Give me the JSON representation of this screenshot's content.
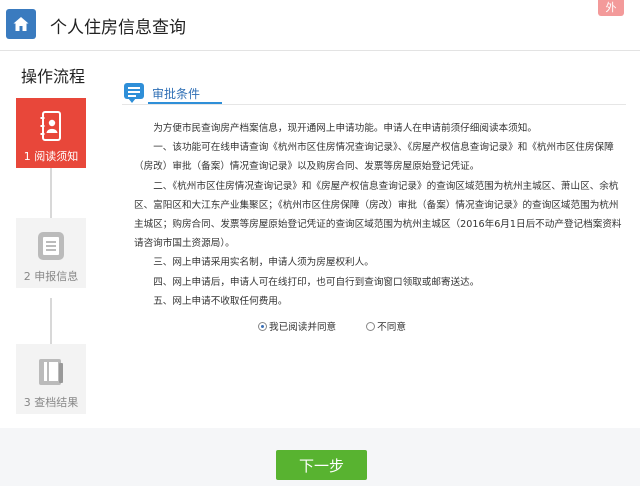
{
  "header": {
    "title": "个人住房信息查询",
    "close_label": "外"
  },
  "steps": {
    "title": "操作流程",
    "items": [
      {
        "label": "1 阅读须知"
      },
      {
        "label": "2 申报信息"
      },
      {
        "label": "3 查档结果"
      }
    ]
  },
  "section": {
    "title": "审批条件"
  },
  "notice": {
    "paragraphs": [
      "为方便市民查询房产档案信息，现开通网上申请功能。申请人在申请前须仔细阅读本须知。",
      "一、该功能可在线申请查询《杭州市区住房情况查询记录》、《房屋产权信息查询记录》和《杭州市区住房保障（房改）审批（备案）情况查询记录》以及购房合同、发票等房屋原始登记凭证。",
      "二、《杭州市区住房情况查询记录》和《房屋产权信息查询记录》的查询区域范围为杭州主城区、萧山区、余杭区、富阳区和大江东产业集聚区；《杭州市区住房保障（房改）审批（备案）情况查询记录》的查询区域范围为杭州主城区；购房合同、发票等房屋原始登记凭证的查询区域范围为杭州主城区（2016年6月1日后不动产登记档案资料请咨询市国土资源局）。",
      "三、网上申请采用实名制，申请人须为房屋权利人。",
      "四、网上申请后，申请人可在线打印，也可自行到查询窗口领取或邮寄送达。",
      "五、网上申请不收取任何费用。"
    ],
    "agree_label": "我已阅读并同意",
    "disagree_label": "不同意",
    "selected": "agree"
  },
  "footer": {
    "next_label": "下一步"
  },
  "colors": {
    "brand_blue": "#3a7bbf",
    "active_step": "#e8473a",
    "next_button": "#58b330"
  }
}
